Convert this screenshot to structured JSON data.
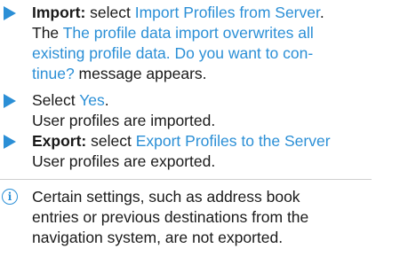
{
  "colors": {
    "accent": "#2b8fd6",
    "text": "#1a1a1a"
  },
  "steps": {
    "import": {
      "icon": "arrow-right-icon",
      "label": "Import:",
      "verb": " select ",
      "option": "Import Profiles from Server",
      "period": ".",
      "line2_prefix": "The ",
      "message_line2": "The profile data import overwrites all",
      "message_line3": "existing profile data. Do you want to con-",
      "message_line4": "tinue?",
      "suffix": " message appears."
    },
    "yes": {
      "icon": "arrow-right-icon",
      "verb": "Select ",
      "option": "Yes",
      "period": ".",
      "result": "User profiles are imported."
    },
    "export": {
      "icon": "arrow-right-icon",
      "label": "Export:",
      "verb": " select ",
      "option": "Export Profiles to the Server",
      "result": "User profiles are exported."
    }
  },
  "note": {
    "icon": "info-icon",
    "line1": "Certain settings, such as address book",
    "line2": "entries or previous destinations from the",
    "line3": "navigation system, are not exported."
  }
}
